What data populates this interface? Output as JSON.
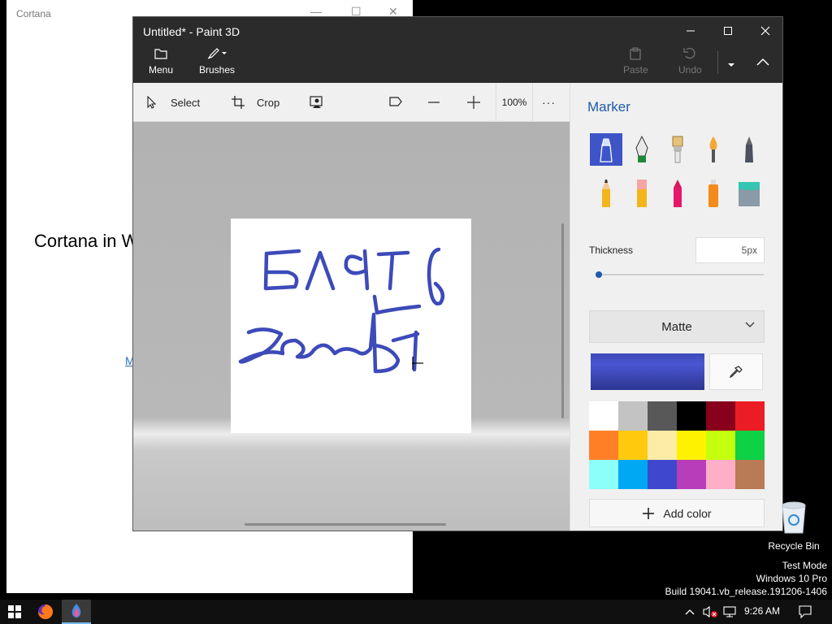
{
  "cortana": {
    "title": "Cortana",
    "heading": "Cortana in W",
    "link": "M"
  },
  "paint": {
    "title": "Untitled* - Paint 3D",
    "ribbon": {
      "menu_label": "Menu",
      "brushes_label": "Brushes",
      "paste_label": "Paste",
      "undo_label": "Undo"
    },
    "toolbar": {
      "select_label": "Select",
      "crop_label": "Crop",
      "zoom": "100%",
      "more": "···"
    },
    "panel": {
      "title": "Marker",
      "thickness_label": "Thickness",
      "thickness_value": "5px",
      "thickness_fraction": 0.0,
      "finish": "Matte",
      "current_color": "#3d4ab9",
      "add_color_label": "Add color",
      "brushes": [
        "marker",
        "calligraphy-pen",
        "oil-brush",
        "watercolor",
        "pixel-pen",
        "pencil",
        "eraser",
        "crayon",
        "spray-can",
        "fill"
      ],
      "selected_brush": "marker"
    }
  },
  "palette": [
    "#ffffff",
    "#c3c3c3",
    "#585858",
    "#000000",
    "#88001b",
    "#ec1c24",
    "#ff7f27",
    "#ffc90e",
    "#fdeca6",
    "#fff200",
    "#c4ff0e",
    "#0ed145",
    "#8cfffb",
    "#00a8f3",
    "#3f48cc",
    "#b83dba",
    "#ffaec8",
    "#b97a56"
  ],
  "desktop": {
    "recycle_bin": "Recycle Bin",
    "watermark_line1": "Test Mode",
    "watermark_line2": "Windows 10 Pro",
    "watermark_line3": "Build 19041.vb_release.191206-1406"
  },
  "taskbar": {
    "clock": "9:26 AM"
  }
}
